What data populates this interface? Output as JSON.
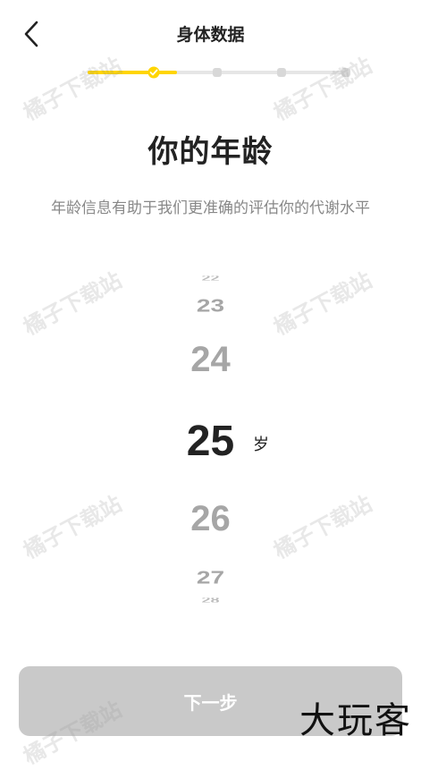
{
  "header": {
    "title": "身体数据"
  },
  "progress": {
    "steps_total": 4,
    "current_step": 1,
    "accent_color": "#FFD500",
    "inactive_color": "#E6E6E6"
  },
  "page": {
    "heading": "你的年龄",
    "subheading": "年龄信息有助于我们更准确的评估你的代谢水平"
  },
  "picker": {
    "values": [
      "22",
      "23",
      "24",
      "25",
      "26",
      "27",
      "28"
    ],
    "selected": "25",
    "unit": "岁"
  },
  "footer": {
    "next_label": "下一步"
  },
  "watermark": {
    "text": "橘子下载站",
    "corner_logo": "大玩客"
  }
}
